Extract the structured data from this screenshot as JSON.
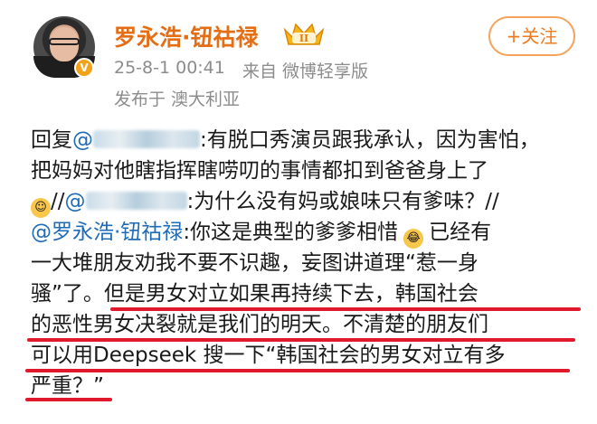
{
  "user": {
    "name": "罗永浩·钮祜禄",
    "level_badge": "II",
    "verified_mark": "V",
    "time": "25-8-1 00:41",
    "source": "来自 微博轻享版",
    "location": "发布于 澳大利亚"
  },
  "follow_label": "+关注",
  "post": {
    "l1_a": "回复",
    "l1_mention": "@",
    "l1_b": ":有脱口秀演员跟我承认，因为害怕，",
    "l2": "把妈妈对他瞎指挥瞎唠叨的事情都扣到爸爸身上了",
    "l3_sep": "//",
    "l3_mention": "@",
    "l3_b": ":为什么没有妈或娘味只有爹味？//",
    "l4_mention": "@罗永浩·钮祜禄",
    "l4_b": ":你这是典型的爹爹相惜",
    "l4_c": "已经有",
    "l5": "一大堆朋友劝我不要不识趣，妄图讲道理“惹一身",
    "l6_a": "骚”了。",
    "l6_b": "但是男女对立如果再持续下去，韩国社会",
    "l7": "的恶性男女决裂就是我们的明天。不清楚的朋友们",
    "l8": "可以用Deepseek 搜一下“韩国社会的男女对立有多",
    "l9": "严重？”"
  },
  "colors": {
    "username": "#e46e15",
    "mention": "#1e6bb8",
    "meta": "#8c8c8c",
    "underline": "#e01a2c",
    "follow_border": "#f5a25a"
  },
  "icons": [
    "avatar",
    "verified-badge-icon",
    "crown-level-icon",
    "smile-emoji-icon",
    "laugh-cry-emoji-icon"
  ]
}
